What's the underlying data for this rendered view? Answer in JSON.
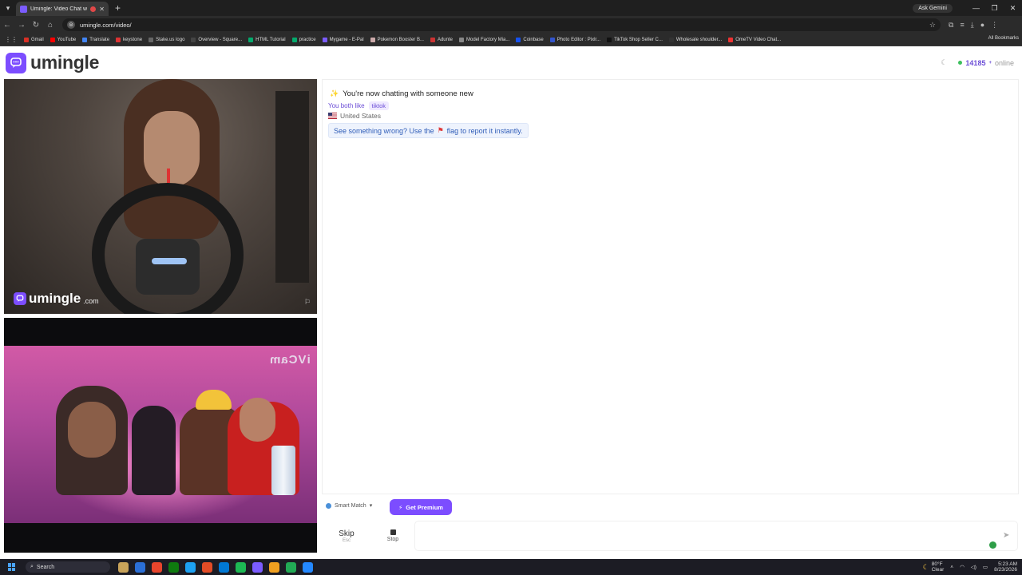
{
  "browser": {
    "tab_title": "Umingle: Video Chat with S",
    "url": "umingle.com/video/",
    "ask_gemini": "Ask Gemini",
    "all_bookmarks": "All Bookmarks",
    "bookmarks": [
      {
        "label": "Gmail",
        "color": "#d93025"
      },
      {
        "label": "YouTube",
        "color": "#ff0000"
      },
      {
        "label": "Translate",
        "color": "#4285f4"
      },
      {
        "label": "keystone",
        "color": "#d33"
      },
      {
        "label": "Stake.us logo",
        "color": "#666"
      },
      {
        "label": "Overview - Square...",
        "color": "#444"
      },
      {
        "label": "HTML Tutorial",
        "color": "#04aa6d"
      },
      {
        "label": "practice",
        "color": "#04aa6d"
      },
      {
        "label": "Mygame - E-Pal",
        "color": "#7b5cff"
      },
      {
        "label": "Pokemon Booster B...",
        "color": "#caa"
      },
      {
        "label": "Adunte",
        "color": "#c33"
      },
      {
        "label": "Model Factory Mia...",
        "color": "#888"
      },
      {
        "label": "Coinbase",
        "color": "#1652f0"
      },
      {
        "label": "Photo Editor : Pixlr...",
        "color": "#35c"
      },
      {
        "label": "TikTok Shop Seller C...",
        "color": "#111"
      },
      {
        "label": "Wholesale shoulder...",
        "color": "#333"
      },
      {
        "label": "OmeTV Video Chat...",
        "color": "#e33"
      }
    ]
  },
  "header": {
    "logo_text": "umingle",
    "online_count": "14185",
    "online_plus": "+",
    "online_label": "online"
  },
  "stranger_video": {
    "watermark": "umingle",
    "watermark_suffix": ".com"
  },
  "self_video": {
    "overlay_text": "iVCam"
  },
  "chat": {
    "status_text": "You're now chatting with someone new",
    "likes_prefix": "You both like",
    "likes_tag": "tiktok",
    "country": "United States",
    "notice_before": "See something wrong? Use the",
    "notice_after": "flag to report it instantly."
  },
  "controls": {
    "smart_match": "Smart Match",
    "premium": "Get Premium",
    "skip_label": "Skip",
    "skip_key": "Esc",
    "stop_label": "Stop",
    "message_placeholder": ""
  },
  "taskbar": {
    "search": "Search",
    "temperature": "80°F",
    "weather": "Clear",
    "time": "5:23 AM",
    "date": "8/23/2026",
    "apps": [
      "#c8a35a",
      "#2b6fd6",
      "#e8452c",
      "#0f7b0f",
      "#1da1f2",
      "#e34c26",
      "#0078d4",
      "#1db954",
      "#7b5cff",
      "#f0a020",
      "#22aa55",
      "#2488ff"
    ]
  }
}
